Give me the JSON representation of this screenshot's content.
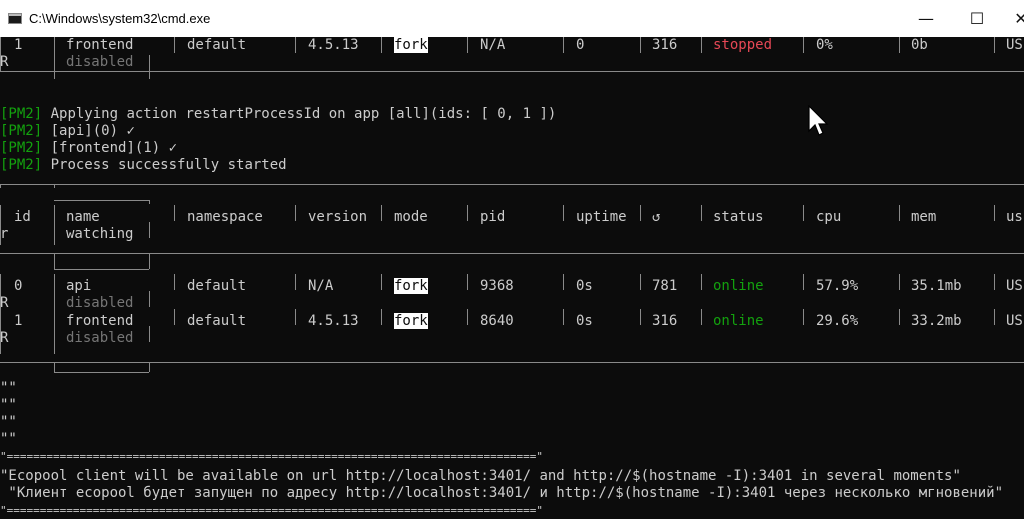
{
  "window": {
    "title": "C:\\Windows\\system32\\cmd.exe",
    "minimize_glyph": "—",
    "maximize_glyph": "☐",
    "close_glyph": "✕"
  },
  "top_table_row": {
    "id_prefix": "",
    "id": "1",
    "name": "frontend",
    "namespace": "default",
    "version": "4.5.13",
    "mode": "fork",
    "pid": "N/A",
    "uptime": "0",
    "restarts": "316",
    "status": "stopped",
    "cpu": "0%",
    "mem": "0b",
    "user": "US",
    "wrap_char": "R",
    "watching": "disabled"
  },
  "log": [
    {
      "prefix": "[PM2]",
      "text": " Applying action restartProcessId on app [all](ids: [ 0, 1 ])"
    },
    {
      "prefix": "[PM2]",
      "text": " [api](0) ✓"
    },
    {
      "prefix": "[PM2]",
      "text": " [frontend](1) ✓"
    },
    {
      "prefix": "[PM2]",
      "text": " Process successfully started"
    }
  ],
  "header": {
    "id": "id",
    "name": "name",
    "watching": "watching",
    "namespace": "namespace",
    "version": "version",
    "mode": "mode",
    "pid": "pid",
    "uptime": "uptime",
    "restarts": "↺",
    "status": "status",
    "cpu": "cpu",
    "mem": "mem",
    "user": "us",
    "wrap_char": "r"
  },
  "rows": [
    {
      "id": "0",
      "name": "api",
      "namespace": "default",
      "version": "N/A",
      "mode": "fork",
      "pid": "9368",
      "uptime": "0s",
      "restarts": "781",
      "status": "online",
      "cpu": "57.9%",
      "mem": "35.1mb",
      "user": "US",
      "wrap_char": "R",
      "watching": "disabled"
    },
    {
      "id": "1",
      "name": "frontend",
      "namespace": "default",
      "version": "4.5.13",
      "mode": "fork",
      "pid": "8640",
      "uptime": "0s",
      "restarts": "316",
      "status": "online",
      "cpu": "29.6%",
      "mem": "33.2mb",
      "user": "US",
      "wrap_char": "R",
      "watching": "disabled"
    }
  ],
  "quotes": [
    "\"\"",
    "\"\"",
    "\"\"",
    "\"\""
  ],
  "banner": {
    "rule": "\"================================================================================\"",
    "line1": "\"Ecopool client will be available on url http://localhost:3401/ and http://$(hostname -I):3401 in several moments\"",
    "line2": " \"Клиент ecopool будет запущен по адресу http://localhost:3401/ и http://$(hostname -I):3401 через несколько мгновений\"",
    "rule2": "\"================================================================================\""
  }
}
